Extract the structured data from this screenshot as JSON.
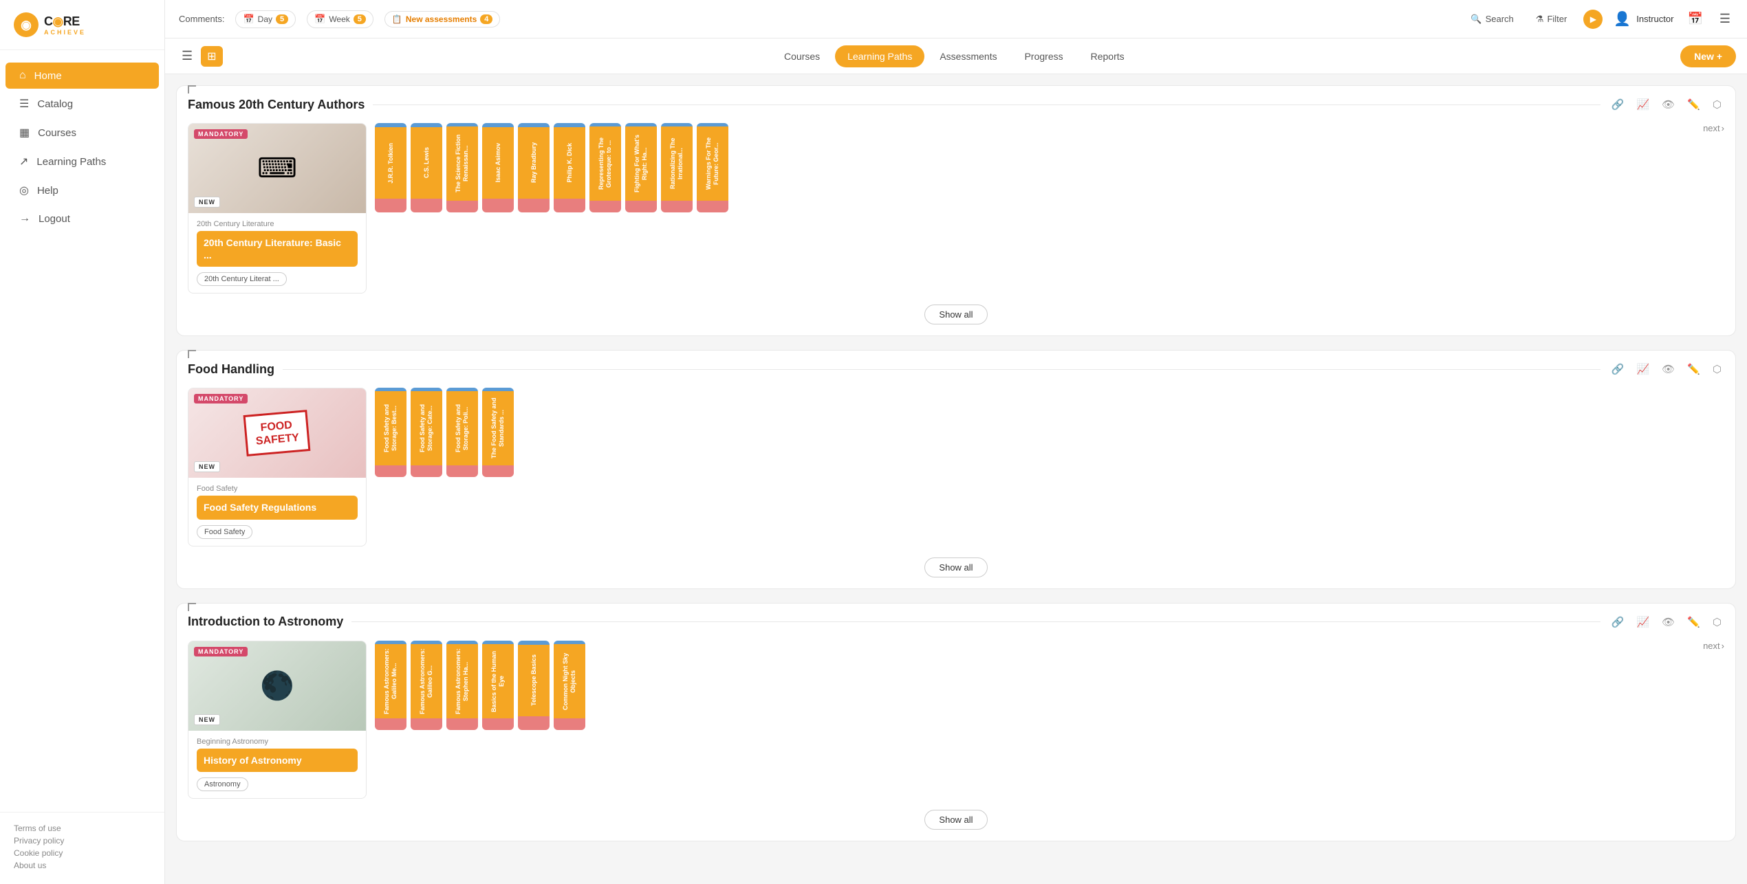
{
  "app": {
    "logo_core": "C☀RE",
    "logo_achieve": "ACHIEVE"
  },
  "topbar": {
    "comments_label": "Comments:",
    "day_label": "Day",
    "day_count": "5",
    "week_label": "Week",
    "week_count": "5",
    "new_assessments_label": "New assessments",
    "new_assessments_count": "4",
    "search_label": "Search",
    "filter_label": "Filter",
    "user_name": "Instructor",
    "new_plus_label": "New +"
  },
  "sidebar": {
    "nav_items": [
      {
        "id": "home",
        "label": "Home",
        "icon": "⌂",
        "active": true
      },
      {
        "id": "catalog",
        "label": "Catalog",
        "icon": "☰",
        "active": false
      },
      {
        "id": "courses",
        "label": "Courses",
        "icon": "▦",
        "active": false
      },
      {
        "id": "learning-paths",
        "label": "Learning Paths",
        "icon": "↗",
        "active": false
      },
      {
        "id": "help",
        "label": "Help",
        "icon": "◎",
        "active": false
      },
      {
        "id": "logout",
        "label": "Logout",
        "icon": "→",
        "active": false
      }
    ],
    "footer_links": [
      {
        "id": "terms",
        "label": "Terms of use"
      },
      {
        "id": "privacy",
        "label": "Privacy policy"
      },
      {
        "id": "cookie",
        "label": "Cookie policy"
      },
      {
        "id": "about",
        "label": "About us"
      }
    ]
  },
  "lp_navbar": {
    "tabs": [
      {
        "id": "courses",
        "label": "Courses",
        "active": false
      },
      {
        "id": "learning-paths",
        "label": "Learning Paths",
        "active": true
      },
      {
        "id": "assessments",
        "label": "Assessments",
        "active": false
      },
      {
        "id": "progress",
        "label": "Progress",
        "active": false
      },
      {
        "id": "reports",
        "label": "Reports",
        "active": false
      }
    ],
    "new_plus": "New +"
  },
  "sections": [
    {
      "id": "famous-authors",
      "title": "Famous 20th Century Authors",
      "main_course": {
        "category": "20th Century Literature",
        "title": "20th Century Literature: Basic ...",
        "tag": "20th Century Literat ...",
        "thumbnail_type": "typewriter",
        "mandatory": "MANDATORY",
        "new": "NEW"
      },
      "mini_courses": [
        {
          "id": "tolkien",
          "label": "J.R.R. Tolkien"
        },
        {
          "id": "lewis",
          "label": "C.S. Lewis"
        },
        {
          "id": "scifi",
          "label": "The Science Fiction Renaissan..."
        },
        {
          "id": "asimov",
          "label": "Isaac Asimov"
        },
        {
          "id": "bradbury",
          "label": "Ray Bradbury"
        },
        {
          "id": "dick",
          "label": "Philip K. Dick"
        },
        {
          "id": "representing",
          "label": "Representing The Grotesque: to ..."
        },
        {
          "id": "fighting",
          "label": "Fighting For What's Right: Ha..."
        },
        {
          "id": "rationalizing",
          "label": "Rationalizing The Irrational..."
        },
        {
          "id": "warnings",
          "label": "Warnings For The Future: Geor..."
        }
      ],
      "show_all": "Show all",
      "next_label": "next"
    },
    {
      "id": "food-handling",
      "title": "Food Handling",
      "main_course": {
        "category": "Food Safety",
        "title": "Food Safety Regulations",
        "tag": "Food Safety",
        "thumbnail_type": "food",
        "mandatory": "MANDATORY",
        "new": "NEW"
      },
      "mini_courses": [
        {
          "id": "fs1",
          "label": "Food Safety and Storage: Best..."
        },
        {
          "id": "fs2",
          "label": "Food Safety and Storage: Cate..."
        },
        {
          "id": "fs3",
          "label": "Food Safety and Storage: Poli..."
        },
        {
          "id": "fs4",
          "label": "The Food Safety and Standards ..."
        }
      ],
      "show_all": "Show all"
    },
    {
      "id": "intro-astronomy",
      "title": "Introduction to Astronomy",
      "main_course": {
        "category": "Beginning Astronomy",
        "title": "History of Astronomy",
        "tag": "Astronomy",
        "thumbnail_type": "astronomy",
        "mandatory": "MANDATORY",
        "new": "NEW"
      },
      "mini_courses": [
        {
          "id": "ast1",
          "label": "Famous Astronomers: Galileo Me..."
        },
        {
          "id": "ast2",
          "label": "Famous Astronomers: Galileo G..."
        },
        {
          "id": "ast3",
          "label": "Famous Astronomers: Stephen Ha..."
        },
        {
          "id": "ast4",
          "label": "Basics of the Human Eye"
        },
        {
          "id": "ast5",
          "label": "Telescope Basics"
        },
        {
          "id": "ast6",
          "label": "Common Night Sky Objects"
        }
      ],
      "show_all": "Show all",
      "next_label": "next"
    }
  ]
}
